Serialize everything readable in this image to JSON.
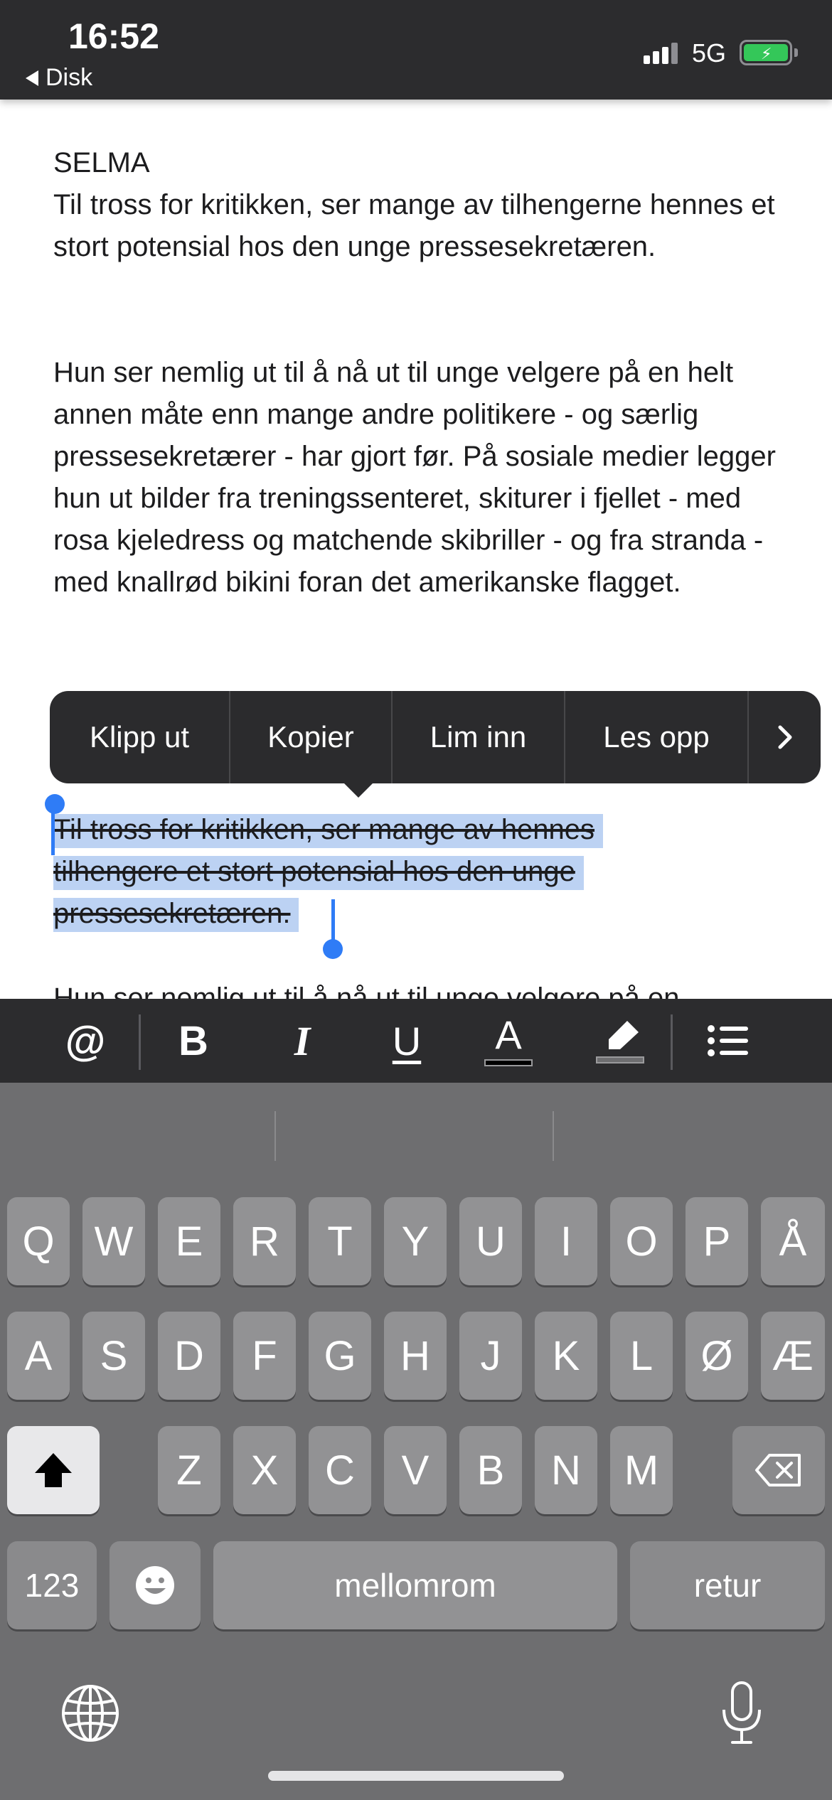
{
  "status_bar": {
    "time": "16:52",
    "back_label": "Disk",
    "network": "5G",
    "icons": [
      "signal-icon",
      "battery-charging-icon"
    ]
  },
  "document": {
    "heading": "SELMA",
    "paragraph1": "Til tross for kritikken, ser mange av tilhengerne hennes et stort potensial hos den unge pressesekretæren.",
    "paragraph2": "Hun ser nemlig ut til å nå ut til unge velgere på en helt annen måte enn mange andre politikere - og særlig pressesekretærer - har gjort før. På sosiale medier legger hun ut bilder fra treningssenteret, skiturer i fjellet - med rosa kjeledress og matchende skibriller - og fra stranda - med knallrød bikini foran det amerikanske flagget.",
    "selected_lines": [
      "Til tross for kritikken, ser mange av hennes",
      "tilhengere et stort potensial hos den unge",
      "pressesekretæren."
    ],
    "paragraph4_partial": "Hun ser nemlig ut til å nå ut til unge velgere på en"
  },
  "edit_menu": {
    "items": [
      "Klipp ut",
      "Kopier",
      "Lim inn",
      "Les opp"
    ],
    "more_icon": "chevron-right-icon"
  },
  "format_toolbar": {
    "icons": [
      "at-sign-icon",
      "bold-icon",
      "italic-icon",
      "underline-icon",
      "text-color-icon",
      "highlight-icon",
      "bullet-list-icon"
    ],
    "bold": "B",
    "italic": "I",
    "underline": "U",
    "text_color": "A",
    "at": "@"
  },
  "keyboard": {
    "row1": [
      "Q",
      "W",
      "E",
      "R",
      "T",
      "Y",
      "U",
      "I",
      "O",
      "P",
      "Å"
    ],
    "row2": [
      "A",
      "S",
      "D",
      "F",
      "G",
      "H",
      "J",
      "K",
      "L",
      "Ø",
      "Æ"
    ],
    "row3": [
      "Z",
      "X",
      "C",
      "V",
      "B",
      "N",
      "M"
    ],
    "numbers_key": "123",
    "space_key": "mellomrom",
    "return_key": "retur",
    "icons": [
      "shift-icon",
      "backspace-icon",
      "emoji-icon",
      "globe-icon",
      "microphone-icon"
    ]
  },
  "colors": {
    "selection": "#bcd2f3",
    "handle": "#2f7cf6",
    "toolbar": "#2c2c2e",
    "keyboard": "#6e6e70"
  }
}
